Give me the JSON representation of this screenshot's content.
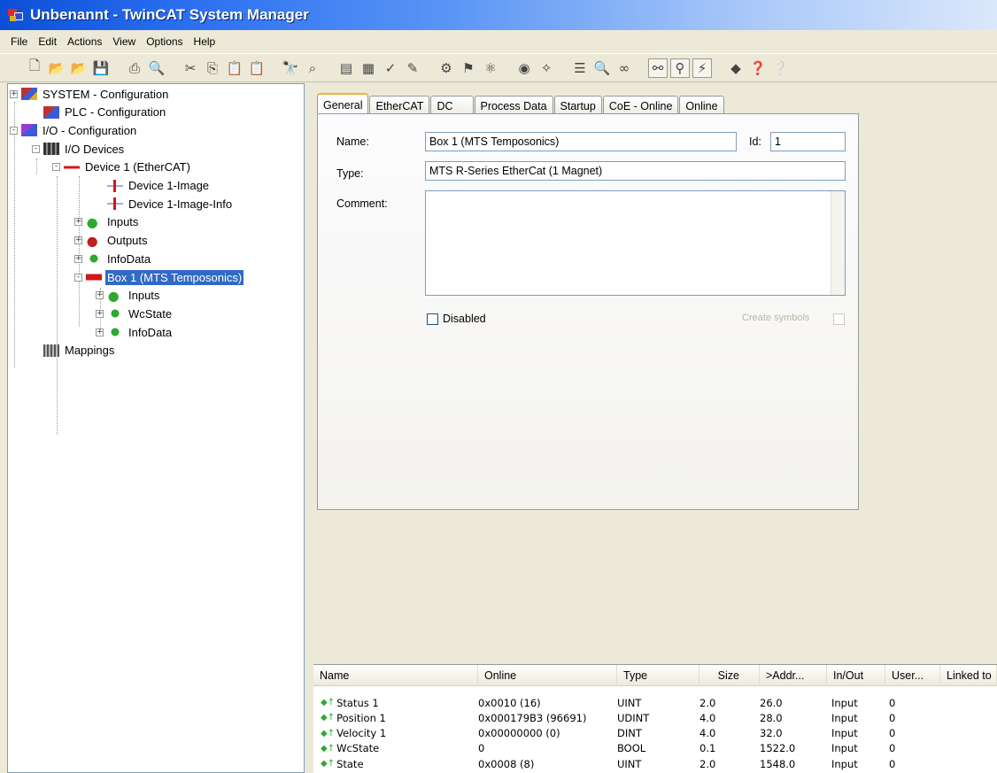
{
  "window": {
    "title": "Unbenannt - TwinCAT System Manager"
  },
  "menu": [
    "File",
    "Edit",
    "Actions",
    "View",
    "Options",
    "Help"
  ],
  "toolbar": {
    "icons": [
      "new-icon",
      "open-icon",
      "open-folder-icon",
      "save-icon",
      "sep",
      "print-icon",
      "print-preview-icon",
      "sep",
      "cut-icon",
      "copy-icon",
      "paste-icon",
      "paste-special-icon",
      "sep",
      "find-icon",
      "find-next-icon",
      "sep",
      "generate-mappings-icon",
      "check-config-icon",
      "activate-config-icon",
      "restart-icon",
      "sep",
      "set-run-icon",
      "set-config-icon",
      "scan-icon",
      "sep",
      "target-icon",
      "network-icon",
      "sep",
      "list-icon",
      "zoom-icon",
      "variable-icon",
      "sep",
      "watch-icon",
      "free-run-icon",
      "online-icon",
      "sep",
      "help-book-icon",
      "help-icon",
      "context-help-icon"
    ],
    "glyphs": [
      "🗋",
      "📂",
      "📂",
      "💾",
      "",
      "⎙",
      "🔍",
      "",
      "✂",
      "⎘",
      "📋",
      "📋",
      "",
      "🔭",
      "⌕",
      "",
      "▤",
      "▦",
      "✓",
      "✎",
      "",
      "⚙",
      "⚑",
      "⚛",
      "",
      "◉",
      "✧",
      "",
      "☰",
      "🔍",
      "∞",
      "",
      "⚯",
      "⚲",
      "⚡",
      "",
      "◆",
      "❓",
      "❔"
    ]
  },
  "tree": [
    {
      "label": "SYSTEM - Configuration",
      "icon": "system-config-icon",
      "exp": "+"
    },
    {
      "label": "PLC - Configuration",
      "icon": "plc-config-icon",
      "exp": ""
    },
    {
      "label": "I/O - Configuration",
      "icon": "io-config-icon",
      "exp": "-"
    },
    {
      "label": "I/O Devices",
      "icon": "io-devices-icon",
      "exp": "-"
    },
    {
      "label": "Device 1 (EtherCAT)",
      "icon": "ethercat-device-icon",
      "exp": "-"
    },
    {
      "label": "Device 1-Image",
      "icon": "process-image-icon",
      "exp": ""
    },
    {
      "label": "Device 1-Image-Info",
      "icon": "process-image-icon",
      "exp": ""
    },
    {
      "label": "Inputs",
      "icon": "inputs-icon",
      "exp": "+"
    },
    {
      "label": "Outputs",
      "icon": "outputs-icon",
      "exp": "+"
    },
    {
      "label": "InfoData",
      "icon": "infodata-icon",
      "exp": "+"
    },
    {
      "label": "Box 1 (MTS Temposonics)",
      "icon": "box-icon",
      "exp": "-"
    },
    {
      "label": "Inputs",
      "icon": "inputs-icon",
      "exp": "+"
    },
    {
      "label": "WcState",
      "icon": "infodata-icon",
      "exp": "+"
    },
    {
      "label": "InfoData",
      "icon": "infodata-icon",
      "exp": "+"
    },
    {
      "label": "Mappings",
      "icon": "mappings-icon",
      "exp": ""
    }
  ],
  "tabs": [
    "General",
    "EtherCAT",
    "DC",
    "Process Data",
    "Startup",
    "CoE - Online",
    "Online"
  ],
  "general": {
    "name_label": "Name:",
    "name_value": "Box 1 (MTS Temposonics)",
    "id_label": "Id:",
    "id_value": "1",
    "type_label": "Type:",
    "type_value": "MTS R-Series EtherCat (1 Magnet)",
    "comment_label": "Comment:",
    "comment_value": "",
    "disabled_label": "Disabled",
    "create_symbols_label": "Create symbols"
  },
  "listview": {
    "columns": [
      "Name",
      "Online",
      "Type",
      "Size",
      ">Addr...",
      "In/Out",
      "User...",
      "Linked to"
    ],
    "rows": [
      [
        "Status 1",
        "0x0010 (16)",
        "UINT",
        "2.0",
        "26.0",
        "Input",
        "0"
      ],
      [
        "Position 1",
        "0x000179B3 (96691)",
        "UDINT",
        "4.0",
        "28.0",
        "Input",
        "0"
      ],
      [
        "Velocity 1",
        "0x00000000 (0)",
        "DINT",
        "4.0",
        "32.0",
        "Input",
        "0"
      ],
      [
        "WcState",
        "0",
        "BOOL",
        "0.1",
        "1522.0",
        "Input",
        "0"
      ],
      [
        "State",
        "0x0008 (8)",
        "UINT",
        "2.0",
        "1548.0",
        "Input",
        "0"
      ]
    ]
  }
}
